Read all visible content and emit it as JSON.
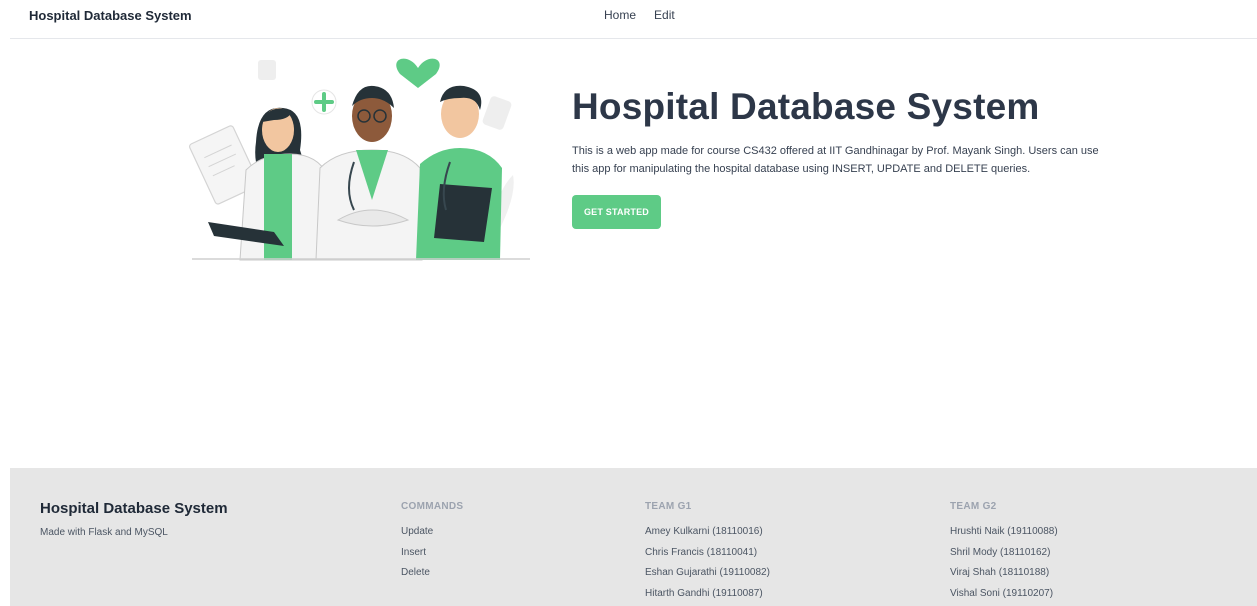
{
  "navbar": {
    "brand": "Hospital Database System",
    "links": [
      "Home",
      "Edit"
    ]
  },
  "hero": {
    "title": "Hospital Database System",
    "description": "This is a web app made for course CS432 offered at IIT Gandhinagar by Prof. Mayank Singh. Users can use this app for manipulating the hospital database using INSERT, UPDATE and DELETE queries.",
    "cta_label": "GET STARTED",
    "illustration": "three medical staff illustration"
  },
  "footer": {
    "brand": "Hospital Database System",
    "tagline": "Made with Flask and MySQL",
    "commands": {
      "heading": "COMMANDS",
      "items": [
        "Update",
        "Insert",
        "Delete"
      ]
    },
    "team_g1": {
      "heading": "TEAM G1",
      "members": [
        "Amey Kulkarni (18110016)",
        "Chris Francis (18110041)",
        "Eshan Gujarathi (19110082)",
        "Hitarth Gandhi (19110087)"
      ]
    },
    "team_g2": {
      "heading": "TEAM G2",
      "members": [
        "Hrushti Naik (19110088)",
        "Shril Mody (18110162)",
        "Viraj Shah (18110188)",
        "Vishal Soni (19110207)"
      ]
    }
  },
  "colors": {
    "accent": "#5ecb86",
    "text": "#2d3748",
    "footer_bg": "#e6e6e6"
  }
}
